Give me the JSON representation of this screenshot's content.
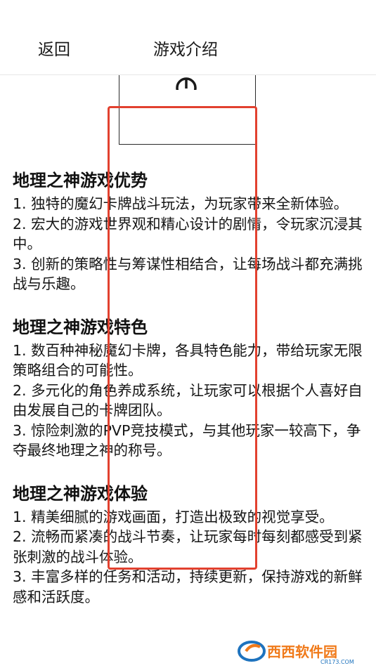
{
  "header": {
    "back_label": "返回",
    "title": "游戏介绍"
  },
  "sections": [
    {
      "title": "地理之神游戏优势",
      "items": [
        "1. 独特的魔幻卡牌战斗玩法，为玩家带来全新体验。",
        "2. 宏大的游戏世界观和精心设计的剧情，令玩家沉浸其中。",
        "3. 创新的策略性与筹谋性相结合，让每场战斗都充满挑战与乐趣。"
      ]
    },
    {
      "title": "地理之神游戏特色",
      "items": [
        "1. 数百种神秘魔幻卡牌，各具特色能力，带给玩家无限策略组合的可能性。",
        "2. 多元化的角色养成系统，让玩家可以根据个人喜好自由发展自己的卡牌团队。",
        "3. 惊险刺激的PVP竞技模式，与其他玩家一较高下，争夺最终地理之神的称号。"
      ]
    },
    {
      "title": "地理之神游戏体验",
      "items": [
        "1. 精美细腻的游戏画面，打造出极致的视觉享受。",
        "2. 流畅而紧凑的战斗节奏，让玩家每时每刻都感受到紧张刺激的战斗体验。",
        "3. 丰富多样的任务和活动，持续更新，保持游戏的新鲜感和活跃度。"
      ]
    }
  ],
  "watermark": {
    "logo_text": "西西软件园",
    "domain": "CR173.COM"
  },
  "colors": {
    "highlight": "#e2412f",
    "watermark_orange": "#f07a1a",
    "watermark_blue": "#1e73be"
  },
  "icons": {
    "preview": "power-icon"
  }
}
